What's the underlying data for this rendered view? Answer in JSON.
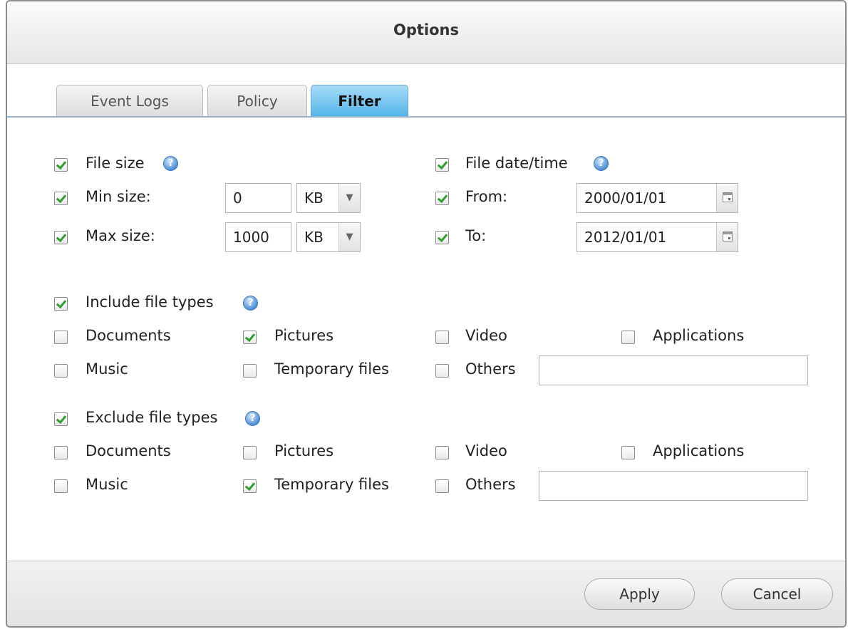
{
  "dialog": {
    "title": "Options"
  },
  "tabs": [
    {
      "label": "Event Logs",
      "active": false
    },
    {
      "label": "Policy",
      "active": false
    },
    {
      "label": "Filter",
      "active": true
    }
  ],
  "file_size": {
    "label": "File size",
    "checked": true,
    "min": {
      "label": "Min size:",
      "checked": true,
      "value": "0",
      "unit": "KB"
    },
    "max": {
      "label": "Max size:",
      "checked": true,
      "value": "1000",
      "unit": "KB"
    }
  },
  "file_date": {
    "label": "File date/time",
    "checked": true,
    "from": {
      "label": "From:",
      "checked": true,
      "value": "2000/01/01"
    },
    "to": {
      "label": "To:",
      "checked": true,
      "value": "2012/01/01"
    }
  },
  "include": {
    "label": "Include file types",
    "checked": true,
    "types": [
      {
        "label": "Documents",
        "checked": false
      },
      {
        "label": "Pictures",
        "checked": true
      },
      {
        "label": "Video",
        "checked": false
      },
      {
        "label": "Applications",
        "checked": false
      },
      {
        "label": "Music",
        "checked": false
      },
      {
        "label": "Temporary files",
        "checked": false
      },
      {
        "label": "Others",
        "checked": false
      }
    ],
    "others_value": ""
  },
  "exclude": {
    "label": "Exclude file types",
    "checked": true,
    "types": [
      {
        "label": "Documents",
        "checked": false
      },
      {
        "label": "Pictures",
        "checked": false
      },
      {
        "label": "Video",
        "checked": false
      },
      {
        "label": "Applications",
        "checked": false
      },
      {
        "label": "Music",
        "checked": false
      },
      {
        "label": "Temporary files",
        "checked": true
      },
      {
        "label": "Others",
        "checked": false
      }
    ],
    "others_value": ""
  },
  "buttons": {
    "apply": "Apply",
    "cancel": "Cancel"
  },
  "icons": {
    "help": "help-icon",
    "calendar": "calendar-icon",
    "dropdown": "chevron-down-icon"
  },
  "help_glyph": "?",
  "dropdown_glyph": "▼"
}
